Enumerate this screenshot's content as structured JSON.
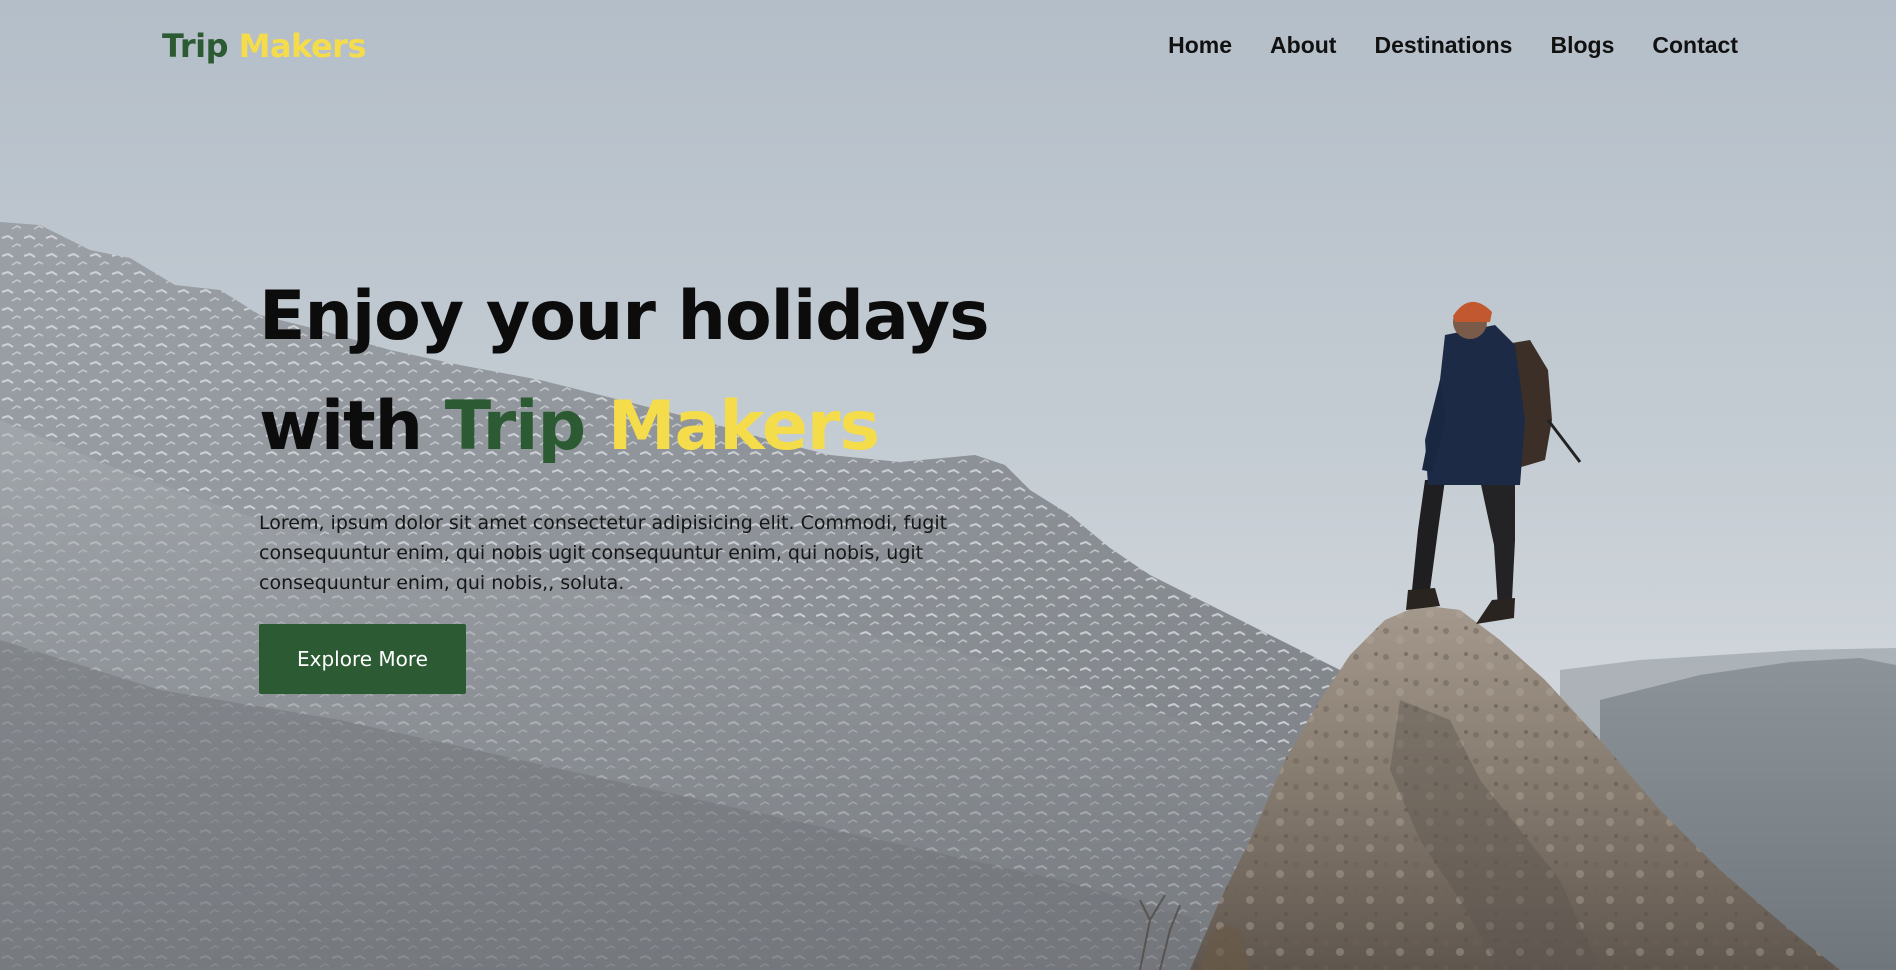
{
  "brand": {
    "name_part1": "Trip",
    "name_part2": "Makers",
    "primary_color": "#2b5a33",
    "accent_color": "#f5dc4a"
  },
  "nav": {
    "items": [
      {
        "label": "Home"
      },
      {
        "label": "About"
      },
      {
        "label": "Destinations"
      },
      {
        "label": "Blogs"
      },
      {
        "label": "Contact"
      }
    ]
  },
  "hero": {
    "title_line1": "Enjoy your holidays",
    "title_line2_prefix": "with",
    "title_brand_part1": "Trip",
    "title_brand_part2": "Makers",
    "description": "Lorem, ipsum dolor sit amet consectetur adipisicing elit. Commodi, fugit consequuntur enim, qui nobis ugit consequuntur enim, qui nobis, ugit consequuntur enim, qui nobis,, soluta.",
    "cta_label": "Explore More",
    "background_image": "hiker-on-mountain-peak"
  }
}
